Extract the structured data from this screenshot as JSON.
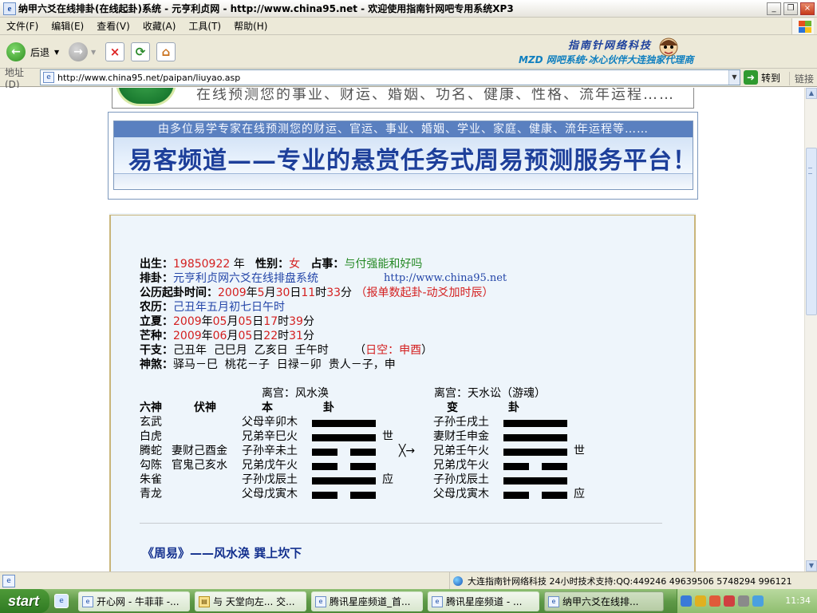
{
  "window": {
    "title": "纳甲六爻在线排卦(在线起卦)系统 - 元亨利贞网 - http://www.china95.net - 欢迎使用指南针网吧专用系统XP3",
    "minimize": "_",
    "restore": "❐",
    "close": "×"
  },
  "menu": [
    "文件(F)",
    "编辑(E)",
    "查看(V)",
    "收藏(A)",
    "工具(T)",
    "帮助(H)"
  ],
  "toolbar": {
    "back_label": "后退",
    "brand_line1": "指南针网络科技",
    "brand_line2": "MZD 网吧系统·冰心伙伴大连独家代理商"
  },
  "address": {
    "label": "地址(D)",
    "url": "http://www.china95.net/paipan/liuyao.asp",
    "go_label": "转到",
    "links_label": "链接"
  },
  "banner1": {
    "text": "在线预测您的事业、财运、婚姻、功名、健康、性格、流年运程……"
  },
  "banner2": {
    "top_text": "由多位易学专家在线预测您的财运、官运、事业、婚姻、学业、家庭、健康、流年运程等……",
    "headline": "易客频道——专业的悬赏任务式周易预测服务平台！"
  },
  "info": {
    "birth_label": "出生：",
    "birth_value": "19850922",
    "birth_unit": " 年",
    "gender_label": "性别：",
    "gender_value": "女",
    "matter_label": "占事：",
    "matter_value": "与付强能和好吗",
    "system_label": "排卦：",
    "system_value": "元亨利贞网六爻在线排盘系统",
    "site": "http://www.china95.net",
    "time_label": "公历起卦时间：",
    "time_y": "2009",
    "time_m": "5",
    "time_d": "30",
    "time_h": "11",
    "time_min": "33",
    "time_note": "（报单数起卦-动爻加时辰）",
    "lunar_label": "农历：",
    "lunar_value": "己丑年五月初七日午时",
    "lixia_label": "立夏：",
    "lixia_y": "2009",
    "lixia_m": "05",
    "lixia_d": "05",
    "lixia_h": "17",
    "lixia_min": "39",
    "mangzhong_label": "芒种：",
    "mz_y": "2009",
    "mz_m": "06",
    "mz_d": "05",
    "mz_h": "22",
    "mz_min": "31",
    "ganzhi_label": "干支：",
    "ganzhi_value": "己丑年  己巳月  乙亥日  壬午时",
    "kong_open": "（",
    "kong_value": "日空：申酉",
    "kong_close": "）",
    "shensha_label": "神煞：",
    "shensha_value": "驿马－巳  桃花－子  日禄－卯  贵人－子，申"
  },
  "u": {
    "nian": "年",
    "yue": "月",
    "ri": "日",
    "shi": "时",
    "fen": "分"
  },
  "gua": {
    "left_palace": "离宫：风水涣",
    "right_palace": "离宫：天水讼（游魂）",
    "col_liushen": "六神",
    "col_fushen": "伏神",
    "col_ben": "本",
    "col_gua": "卦",
    "col_bian": "变",
    "col_gua2": "卦",
    "liushen": [
      "玄武",
      "白虎",
      "腾蛇",
      "勾陈",
      "朱雀",
      "青龙"
    ],
    "fushen": [
      "",
      "",
      "妻财己酉金",
      "官鬼己亥水",
      "",
      ""
    ],
    "ben": [
      "父母辛卯木",
      "兄弟辛巳火",
      "子孙辛未土",
      "兄弟戊午火",
      "子孙戊辰土",
      "父母戊寅木"
    ],
    "ben_lines": [
      "yang",
      "yang",
      "yin",
      "yin",
      "yang",
      "yin"
    ],
    "ben_marks": [
      "",
      "世",
      "",
      "",
      "应",
      ""
    ],
    "moving_mark": "╳→",
    "bian": [
      "子孙壬戌土",
      "妻财壬申金",
      "兄弟壬午火",
      "兄弟戊午火",
      "子孙戊辰土",
      "父母戊寅木"
    ],
    "bian_lines": [
      "yang",
      "yang",
      "yang",
      "yin",
      "yang",
      "yin"
    ],
    "bian_marks": [
      "",
      "",
      "世",
      "",
      "",
      "应"
    ]
  },
  "zhouyi": "《周易》——风水涣  巽上坎下",
  "status": {
    "text": "大连指南针网络科技 24小时技术支持:QQ:449246 49639506 5748294 996121"
  },
  "taskbar": {
    "start": "start",
    "tasks": [
      "开心网 - 牛菲菲 -...",
      "与 天堂向左... 交...",
      "腾讯星座频道_首...",
      "腾讯星座频道 - ...",
      "纳甲六爻在线排..."
    ],
    "clock": "11:34"
  }
}
